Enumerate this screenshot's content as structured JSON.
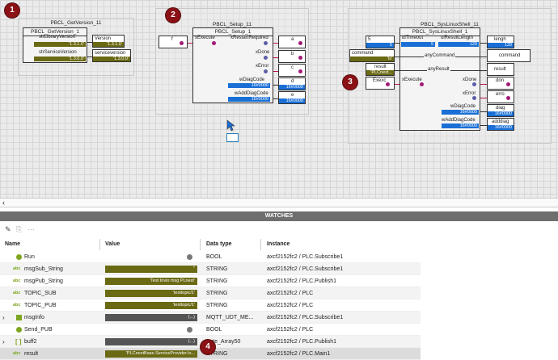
{
  "canvas": {
    "badges": [
      "1",
      "2",
      "3",
      "4"
    ],
    "fb_getversion": {
      "frame_title": "PBCL_GetVersion_11",
      "block_title": "PBCL_GetVersion_1",
      "pins": [
        "strLibraryVersion",
        "strServiceVersion"
      ],
      "vars": [
        {
          "name": "Version",
          "value": "'1.3.1.0'"
        },
        {
          "name": "serviceversion",
          "value": "'1.3.0.0'"
        }
      ],
      "inline_values": [
        "'1.3.1.0'",
        "'1.3.0.0'"
      ]
    },
    "fb_setup": {
      "frame_title": "PBCL_Setup_11",
      "block_title": "PBCL_Setup_1",
      "input_var": "f",
      "in_pins": [
        "xExecute"
      ],
      "out_pins": [
        "xRestartRequired",
        "xDone",
        "xError",
        "wDiagCode",
        "wAddDiagCode"
      ],
      "out_vars": [
        {
          "name": "a",
          "value": ""
        },
        {
          "name": "b",
          "value": ""
        },
        {
          "name": "c",
          "value": ""
        },
        {
          "name": "d",
          "value": "16#0000"
        },
        {
          "name": "e",
          "value": "16#0000"
        }
      ],
      "inline_values": [
        "16#0000",
        "16#0000"
      ]
    },
    "fb_shell": {
      "frame_title": "PBCL_SysLinuxShell_11",
      "block_title": "PBCL_SysLinuxShell_1",
      "in_vars": [
        {
          "name": "5",
          "value": "5"
        },
        {
          "name": "command",
          "value": "'ls'"
        },
        {
          "name": "result",
          "value": "'PLCnext..."
        },
        {
          "name": "Exexc",
          "value": ""
        }
      ],
      "in_pins": [
        "diTimeout",
        "xExecute"
      ],
      "through_pins": [
        "anyCommand",
        "anyResult"
      ],
      "out_pins": [
        "uiResultLength",
        "xDone",
        "xError",
        "wDiagCode",
        "wAddDiagCode"
      ],
      "out_vars": [
        {
          "name": "lengh",
          "value": "129"
        },
        {
          "name": "command",
          "value": ""
        },
        {
          "name": "result",
          "value": ""
        },
        {
          "name": "don",
          "value": ""
        },
        {
          "name": "erro",
          "value": ""
        },
        {
          "name": "diag",
          "value": "16#0000"
        },
        {
          "name": "adddiag",
          "value": "16#0000"
        }
      ],
      "inline_values": [
        "5",
        "129",
        "16#0000",
        "16#0000"
      ]
    }
  },
  "divider": {
    "arrow": "‹"
  },
  "watches": {
    "title": "WATCHES",
    "columns": [
      "Name",
      "Value",
      "Data type",
      "Instance"
    ],
    "rows": [
      {
        "name": "Run",
        "value": "",
        "dtype": "BOOL",
        "instance": "axcf2152fc2 / PLC.Subscribe1",
        "icon": "green-dot-icon",
        "value_type": "dot",
        "expand": ""
      },
      {
        "name": "msgSub_String",
        "value": "''",
        "dtype": "STRING",
        "instance": "axcf2152fc2 / PLC.Subscribe1",
        "icon": "abc-icon",
        "value_type": "olive",
        "expand": ""
      },
      {
        "name": "msgPub_String",
        "value": "'Test Invio msg PLnext'",
        "dtype": "STRING",
        "instance": "axcf2152fc2 / PLC.Publish1",
        "icon": "abc-icon",
        "value_type": "olive",
        "expand": ""
      },
      {
        "name": "TOPIC_SUB",
        "value": "'testtopic/1'",
        "dtype": "STRING",
        "instance": "axcf2152fc2 / PLC",
        "icon": "abc-icon",
        "value_type": "olive",
        "expand": ""
      },
      {
        "name": "TOPIC_PUB",
        "value": "'testtopic/1'",
        "dtype": "STRING",
        "instance": "axcf2152fc2 / PLC",
        "icon": "abc-icon",
        "value_type": "olive",
        "expand": ""
      },
      {
        "name": "msgInfo",
        "value": "(...)",
        "dtype": "MQTT_UDT_ME...",
        "instance": "axcf2152fc2 / PLC.Subscribe1",
        "icon": "struct-icon",
        "value_type": "gray",
        "expand": "›"
      },
      {
        "name": "Send_PUB",
        "value": "",
        "dtype": "BOOL",
        "instance": "axcf2152fc2 / PLC",
        "icon": "green-dot-icon",
        "value_type": "dot",
        "expand": ""
      },
      {
        "name": "buff2",
        "value": "(...)",
        "dtype": "Byte_Array50",
        "instance": "axcf2152fc2 / PLC.Publish1",
        "icon": "array-icon",
        "value_type": "gray",
        "expand": "›"
      },
      {
        "name": "result",
        "value": "'PLCnextBase.ServiceProvider.lo...",
        "dtype": "STRING",
        "instance": "axcf2152fc2 / PLC.Main1",
        "icon": "abc-icon",
        "value_type": "olive",
        "expand": ""
      }
    ]
  },
  "colors": {
    "olive": "#6b6a14",
    "blue": "#1a6fd6",
    "magenta": "#a31a78",
    "badge": "#8a1116"
  }
}
